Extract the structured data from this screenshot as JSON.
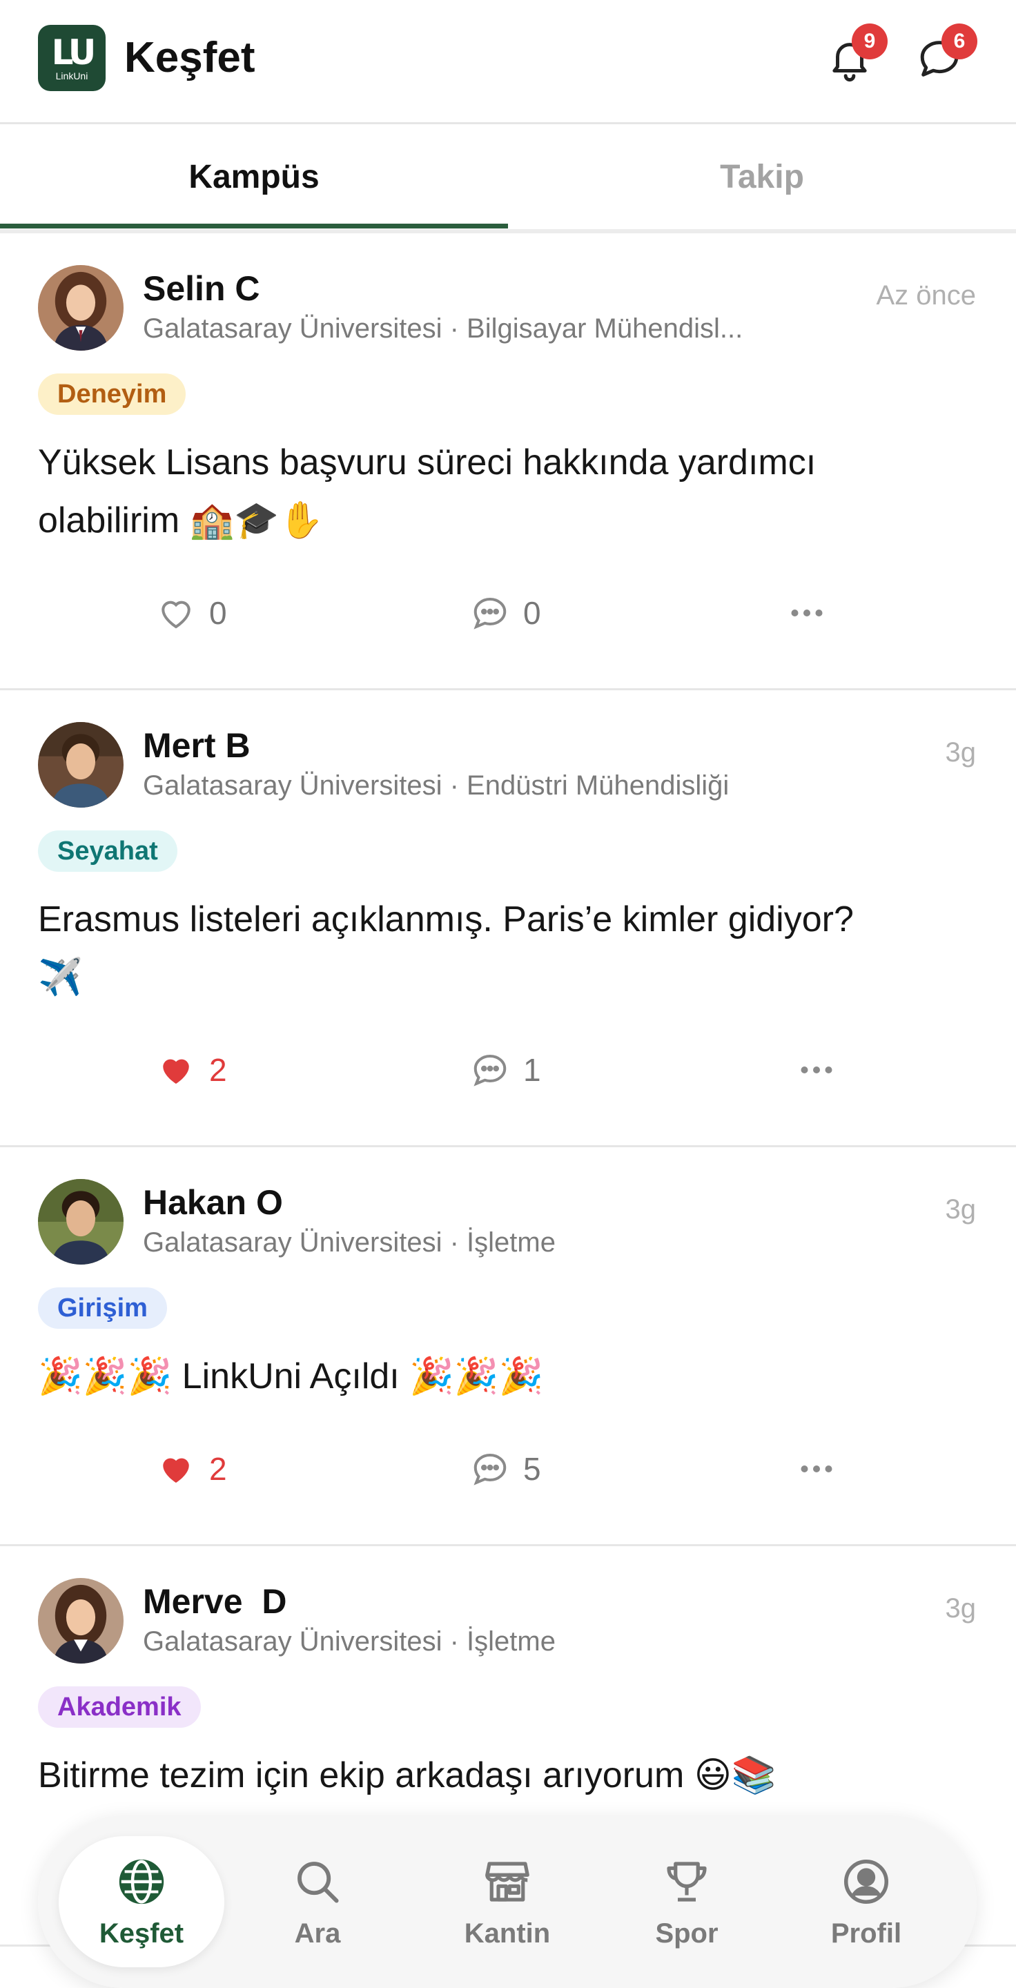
{
  "header": {
    "logo_text": "LU",
    "logo_subtext": "LinkUni",
    "title": "Keşfet",
    "notifications_count": "9",
    "messages_count": "6"
  },
  "tabs": [
    {
      "label": "Kampüs",
      "active": true
    },
    {
      "label": "Takip",
      "active": false
    }
  ],
  "posts": [
    {
      "author": "Selin C",
      "meta": "Galatasaray Üniversitesi · Bilgisayar Mühendisl...",
      "time": "Az önce",
      "tag": "Deneyim",
      "line1": "Yüksek Lisans başvuru süreci hakkında yardımcı",
      "line2": "olabilirim 🏫🎓✋",
      "likes": "0",
      "comments": "0",
      "liked": false
    },
    {
      "author": "Mert B",
      "meta": "Galatasaray Üniversitesi · Endüstri Mühendisliği",
      "time": "3g",
      "tag": "Seyahat",
      "line1": "Erasmus listeleri açıklanmış. Paris’e kimler gidiyor?",
      "line2": "✈️",
      "likes": "2",
      "comments": "1",
      "liked": true
    },
    {
      "author": "Hakan O",
      "meta": "Galatasaray Üniversitesi · İşletme",
      "time": "3g",
      "tag": "Girişim",
      "line1": "🎉🎉🎉 LinkUni Açıldı 🎉🎉🎉",
      "line2": "",
      "likes": "2",
      "comments": "5",
      "liked": true
    },
    {
      "author": "Merve  D",
      "meta": "Galatasaray Üniversitesi · İşletme",
      "time": "3g",
      "tag": "Akademik",
      "line1": "Bitirme tezim için ekip arkadaşı arıyorum 😃📚",
      "line2": "",
      "likes": "",
      "comments": "",
      "liked": false
    }
  ],
  "bottom_nav": [
    {
      "label": "Keşfet",
      "icon": "globe-icon",
      "active": true
    },
    {
      "label": "Ara",
      "icon": "search-icon",
      "active": false
    },
    {
      "label": "Kantin",
      "icon": "store-icon",
      "active": false
    },
    {
      "label": "Spor",
      "icon": "trophy-icon",
      "active": false
    },
    {
      "label": "Profil",
      "icon": "profile-icon",
      "active": false
    }
  ],
  "colors": {
    "brand": "#1f4a34",
    "accent": "#2b5e3d",
    "badge": "#e03b3b",
    "like": "#e03b3b"
  }
}
